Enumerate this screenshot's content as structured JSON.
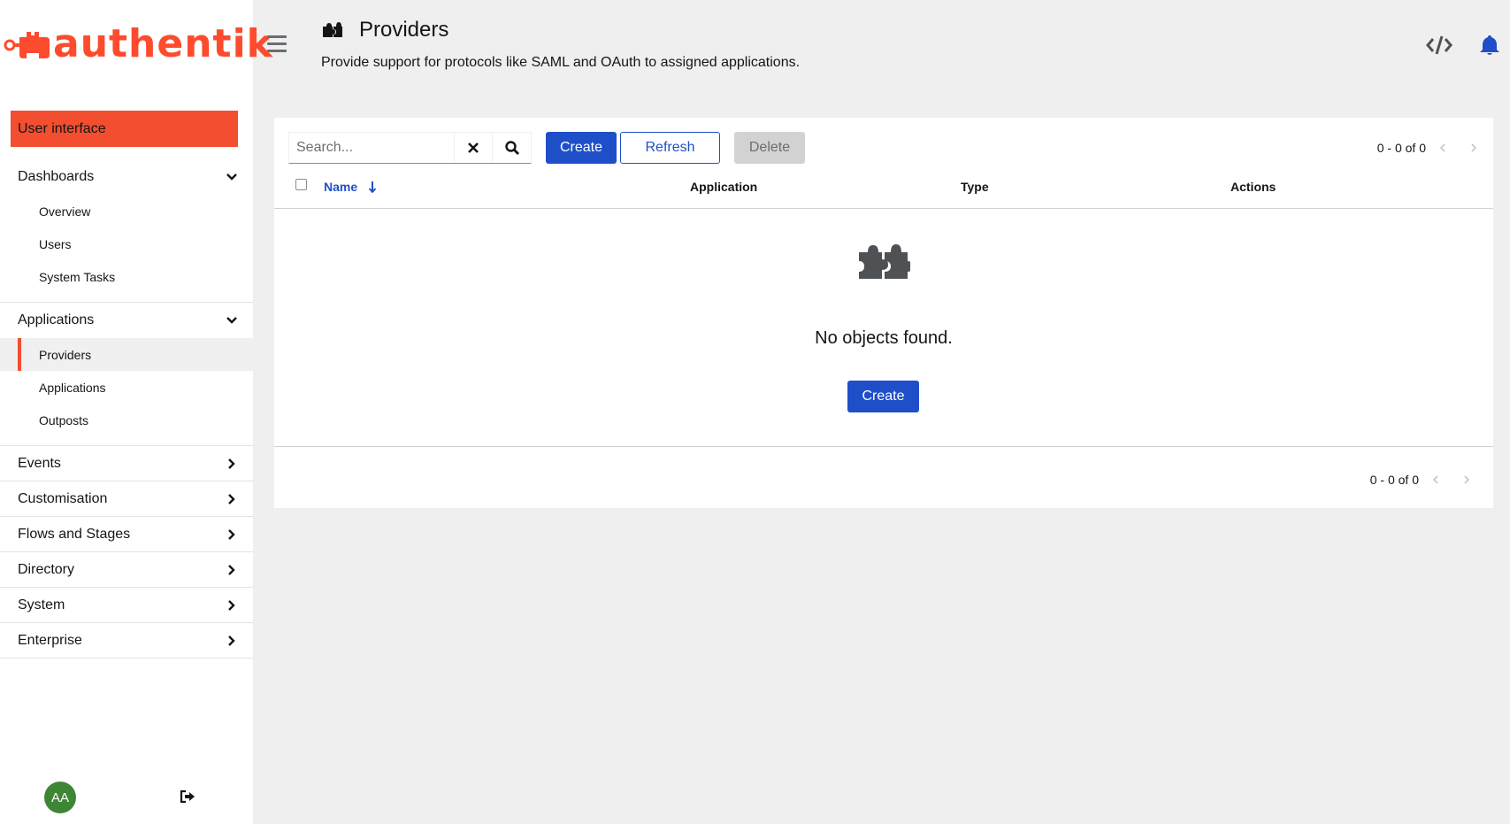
{
  "brand": {
    "name": "authentik",
    "accent": "#fd4b2d"
  },
  "sidebar": {
    "top_button": "User interface",
    "groups": [
      {
        "label": "Dashboards",
        "expanded": true,
        "items": [
          "Overview",
          "Users",
          "System Tasks"
        ]
      },
      {
        "label": "Applications",
        "expanded": true,
        "items": [
          "Providers",
          "Applications",
          "Outposts"
        ],
        "active_item": "Providers"
      },
      {
        "label": "Events",
        "expanded": false
      },
      {
        "label": "Customisation",
        "expanded": false
      },
      {
        "label": "Flows and Stages",
        "expanded": false
      },
      {
        "label": "Directory",
        "expanded": false
      },
      {
        "label": "System",
        "expanded": false
      },
      {
        "label": "Enterprise",
        "expanded": false
      }
    ],
    "avatar_initials": "AA"
  },
  "header": {
    "title": "Providers",
    "description": "Provide support for protocols like SAML and OAuth to assigned applications.",
    "icon": "puzzle-icon"
  },
  "toolbar": {
    "search_placeholder": "Search...",
    "create_label": "Create",
    "refresh_label": "Refresh",
    "delete_label": "Delete"
  },
  "pagination": {
    "top": "0 - 0 of 0",
    "bottom": "0 - 0 of 0"
  },
  "table": {
    "columns": [
      "Name",
      "Application",
      "Type",
      "Actions"
    ],
    "sort_column": "Name"
  },
  "empty_state": {
    "title": "No objects found.",
    "create_label": "Create"
  },
  "colors": {
    "primary": "#1f4fc8",
    "active_marker": "#f24e2f",
    "avatar": "#3e8635"
  }
}
